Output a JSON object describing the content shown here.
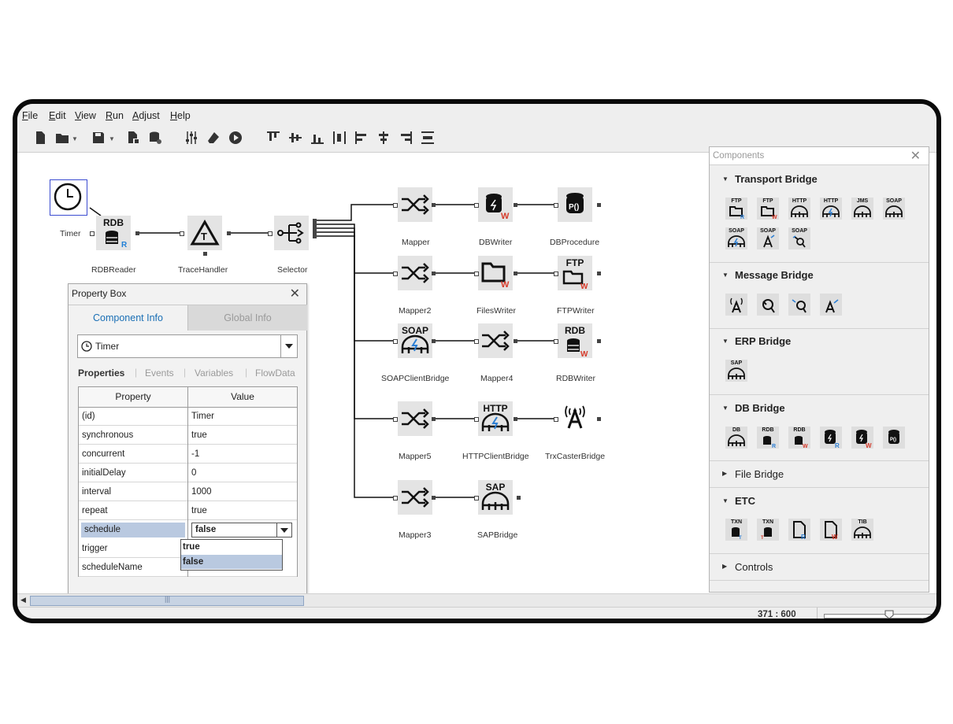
{
  "menu": [
    "File",
    "Edit",
    "View",
    "Run",
    "Adjust",
    "Help"
  ],
  "canvas": {
    "nodes": {
      "timer": "Timer",
      "rdbreader": "RDBReader",
      "tracehandler": "TraceHandler",
      "selector": "Selector",
      "mapper": "Mapper",
      "dbwriter": "DBWriter",
      "dbprocedure": "DBProcedure",
      "mapper2": "Mapper2",
      "fileswriter": "FilesWriter",
      "ftpwriter": "FTPWriter",
      "soapclientbridge": "SOAPClientBridge",
      "mapper4": "Mapper4",
      "rdbwriter": "RDBWriter",
      "mapper5": "Mapper5",
      "httpclientbridge": "HTTPClientBridge",
      "trxcasterbridge": "TrxCasterBridge",
      "mapper3": "Mapper3",
      "sapbridge": "SAPBridge"
    },
    "icon_text": {
      "rdb": "RDB",
      "soap": "SOAP",
      "ftp": "FTP",
      "http": "HTTP",
      "sap": "SAP",
      "rdb_w": "RDB"
    }
  },
  "property_box": {
    "title": "Property Box",
    "tabs": [
      "Component Info",
      "Global Info"
    ],
    "selected_component": "Timer",
    "subtabs": [
      "Properties",
      "Events",
      "Variables",
      "FlowData"
    ],
    "columns": [
      "Property",
      "Value"
    ],
    "rows": [
      {
        "property": "(id)",
        "value": "Timer"
      },
      {
        "property": "synchronous",
        "value": "true"
      },
      {
        "property": "concurrent",
        "value": "-1"
      },
      {
        "property": "initialDelay",
        "value": "0"
      },
      {
        "property": "interval",
        "value": "1000"
      },
      {
        "property": "repeat",
        "value": "true"
      },
      {
        "property": "schedule",
        "value": "false"
      },
      {
        "property": "trigger",
        "value": ""
      },
      {
        "property": "scheduleName",
        "value": ""
      }
    ],
    "dropdown_options": [
      "true",
      "false"
    ]
  },
  "components_panel": {
    "title": "Components",
    "sections": [
      {
        "name": "Transport Bridge",
        "icons": [
          "FTP",
          "FTP",
          "HTTP",
          "HTTP",
          "JMS",
          "SOAP",
          "SOAP",
          "SOAP",
          "SOAP"
        ]
      },
      {
        "name": "Message Bridge",
        "icons": [
          "",
          "",
          "",
          ""
        ]
      },
      {
        "name": "ERP Bridge",
        "icons": [
          "SAP"
        ]
      },
      {
        "name": "DB Bridge",
        "icons": [
          "DB",
          "RDB",
          "RDB",
          "",
          "",
          ""
        ]
      },
      {
        "name": "File Bridge",
        "icons": []
      },
      {
        "name": "ETC",
        "icons": [
          "TXN",
          "TXN",
          "",
          "",
          "TIB"
        ]
      },
      {
        "name": "Controls",
        "icons": []
      }
    ]
  },
  "status": {
    "zoom_readout": "371 : 600",
    "zoom_level_fraction": 0.55
  },
  "colors": {
    "accent": "#1a6fb5",
    "red_badge": "#d63a2a",
    "blue_badge": "#2d7fd3",
    "selection": "#b9c9e0"
  }
}
